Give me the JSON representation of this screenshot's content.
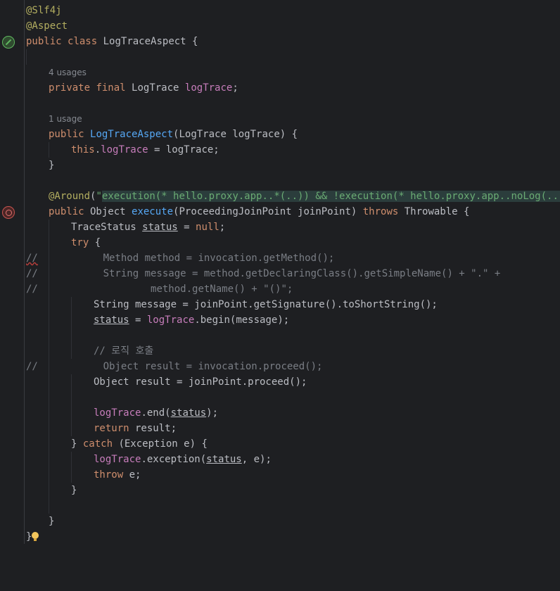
{
  "usages": {
    "four": "4 usages",
    "one": "1 usage"
  },
  "lines": {
    "l1": {
      "ann": "@Slf4j"
    },
    "l2": {
      "ann": "@Aspect"
    },
    "l3": {
      "kw1": "public",
      "kw2": "class",
      "name": "LogTraceAspect",
      "rest": " {"
    },
    "l5": {
      "kw1": "private",
      "kw2": "final",
      "type": " LogTrace ",
      "field": "logTrace",
      "rest": ";"
    },
    "l7": {
      "kw1": "public",
      "name": "LogTraceAspect",
      "rest": "(LogTrace logTrace) {"
    },
    "l8": {
      "kw": "this",
      "dot": ".",
      "field": "logTrace",
      "rest": " = logTrace;"
    },
    "l9": {
      "rest": "}"
    },
    "l11": {
      "ann": "@Around",
      "open": "(",
      "q1": "\"",
      "p1": "execution(* hello.proxy.app..*(..)) && !execution(* hello.proxy.app..noLog(..))",
      "q2": "\"",
      "close": ")"
    },
    "l12": {
      "kw1": "public",
      "type": " Object ",
      "name": "execute",
      "params": "(ProceedingJoinPoint joinPoint) ",
      "kw2": "throws",
      "rest": " Throwable {"
    },
    "l13": {
      "type": "TraceStatus ",
      "var": "status",
      "eq": " = ",
      "kw": "null",
      "semi": ";"
    },
    "l14": {
      "kw": "try",
      "rest": " {"
    },
    "l15": {
      "slashes": "//",
      "gap": "           ",
      "code": "Method method = invocation.getMethod();"
    },
    "l16": {
      "slashes": "//",
      "gap": "           ",
      "code": "String message = method.getDeclaringClass().getSimpleName() + \".\" +"
    },
    "l17": {
      "slashes": "//",
      "gap": "                   ",
      "code": "method.getName() + \"()\";"
    },
    "l18": {
      "rest": "String message = joinPoint.getSignature().toShortString();"
    },
    "l19": {
      "var": "status",
      "eq": " = ",
      "field": "logTrace",
      "rest": ".begin(message);"
    },
    "l21": {
      "cmt": "// 로직 호출"
    },
    "l22": {
      "slashes": "//",
      "gap": "           ",
      "code": "Object result = invocation.proceed();"
    },
    "l23": {
      "rest": "Object result = joinPoint.proceed();"
    },
    "l25": {
      "field": "logTrace",
      "pre": ".end(",
      "var": "status",
      "rest": ");"
    },
    "l26": {
      "kw": "return",
      "rest": " result;"
    },
    "l27": {
      "pre": "} ",
      "kw": "catch",
      "rest": " (Exception e) {"
    },
    "l28": {
      "field": "logTrace",
      "pre": ".exception(",
      "var": "status",
      "rest": ", e);"
    },
    "l29": {
      "kw": "throw",
      "rest": " e;"
    },
    "l30": {
      "rest": "}"
    },
    "l32": {
      "rest": "}"
    },
    "l33": {
      "rest": "}"
    }
  },
  "icons": {
    "gutter_class": "spring-bean-icon",
    "gutter_method": "aop-advice-icon",
    "hint": "lightbulb-icon"
  }
}
